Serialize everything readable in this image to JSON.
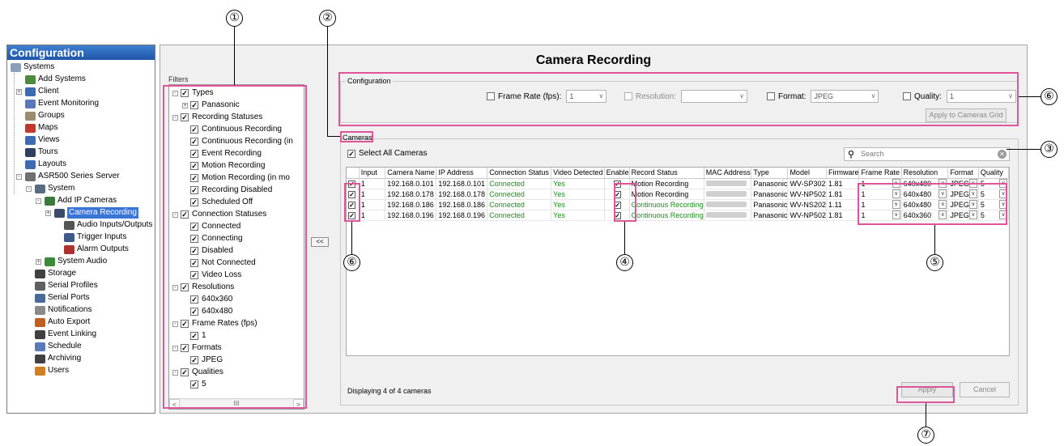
{
  "nav": {
    "header": "Configuration",
    "items": [
      {
        "label": "Systems",
        "color": "#8aa0b8"
      },
      {
        "label": "Add Systems",
        "color": "#4e8a3c"
      },
      {
        "label": "Client",
        "color": "#3d6bb3"
      },
      {
        "label": "Event Monitoring",
        "color": "#5a78b8"
      },
      {
        "label": "Groups",
        "color": "#9a8c6e"
      },
      {
        "label": "Maps",
        "color": "#c0392b"
      },
      {
        "label": "Views",
        "color": "#3d6bb3"
      },
      {
        "label": "Tours",
        "color": "#2f3f5f"
      },
      {
        "label": "Layouts",
        "color": "#3d6bb3"
      },
      {
        "label": "ASR500 Series Server",
        "color": "#707070"
      },
      {
        "label": "System",
        "color": "#5a6a80"
      },
      {
        "label": "Add IP Cameras",
        "color": "#3a7a3a"
      },
      {
        "label": "Camera Recording",
        "color": "#3a4a6a"
      },
      {
        "label": "Audio Inputs/Outputs",
        "color": "#555555"
      },
      {
        "label": "Trigger Inputs",
        "color": "#3d5a8a"
      },
      {
        "label": "Alarm Outputs",
        "color": "#b03030"
      },
      {
        "label": "System Audio",
        "color": "#3a8a3a"
      },
      {
        "label": "Storage",
        "color": "#404040"
      },
      {
        "label": "Serial Profiles",
        "color": "#606060"
      },
      {
        "label": "Serial Ports",
        "color": "#4a6a9a"
      },
      {
        "label": "Notifications",
        "color": "#8a8a8a"
      },
      {
        "label": "Auto Export",
        "color": "#c06020"
      },
      {
        "label": "Event Linking",
        "color": "#404040"
      },
      {
        "label": "Schedule",
        "color": "#5a7ab8"
      },
      {
        "label": "Archiving",
        "color": "#404040"
      },
      {
        "label": "Users",
        "color": "#d08020"
      }
    ]
  },
  "page": {
    "title": "Camera Recording",
    "collapse_label": "<<"
  },
  "filters": {
    "label": "Filters",
    "items": [
      {
        "label": "Types",
        "group": true
      },
      {
        "label": "Panasonic",
        "group": false
      },
      {
        "label": "Recording Statuses",
        "group": true
      },
      {
        "label": "Continuous Recording",
        "group": false
      },
      {
        "label": "Continuous Recording (in",
        "group": false
      },
      {
        "label": "Event Recording",
        "group": false
      },
      {
        "label": "Motion Recording",
        "group": false
      },
      {
        "label": "Motion Recording (in mo",
        "group": false
      },
      {
        "label": "Recording Disabled",
        "group": false
      },
      {
        "label": "Scheduled Off",
        "group": false
      },
      {
        "label": "Connection Statuses",
        "group": true
      },
      {
        "label": "Connected",
        "group": false
      },
      {
        "label": "Connecting",
        "group": false
      },
      {
        "label": "Disabled",
        "group": false
      },
      {
        "label": "Not Connected",
        "group": false
      },
      {
        "label": "Video Loss",
        "group": false
      },
      {
        "label": "Resolutions",
        "group": true
      },
      {
        "label": "640x360",
        "group": false
      },
      {
        "label": "640x480",
        "group": false
      },
      {
        "label": "Frame Rates (fps)",
        "group": true
      },
      {
        "label": "1",
        "group": false
      },
      {
        "label": "Formats",
        "group": true
      },
      {
        "label": "JPEG",
        "group": false
      },
      {
        "label": "Qualities",
        "group": true
      },
      {
        "label": "5",
        "group": false
      }
    ],
    "scroll_left": "<",
    "scroll_right": ">",
    "scroll_thumb": "III"
  },
  "configuration": {
    "label": "Configuration",
    "frame_rate_label": "Frame Rate (fps):",
    "frame_rate_value": "1",
    "resolution_label": "Resolution:",
    "resolution_value": "",
    "format_label": "Format:",
    "format_value": "JPEG",
    "quality_label": "Quality:",
    "quality_value": "1",
    "apply_grid_label": "Apply to Cameras Grid"
  },
  "cameras": {
    "label": "Cameras",
    "select_all_label": "Select All Cameras",
    "search_placeholder": "Search",
    "columns": [
      "",
      "Input",
      "Camera Name",
      "IP Address",
      "Connection Status",
      "Video Detected",
      "Enable",
      "Record Status",
      "MAC Address",
      "Type",
      "Model",
      "Firmware",
      "Frame Rate",
      "Resolution",
      "Format",
      "Quality"
    ],
    "rows": [
      {
        "input": "1",
        "name": "192.168.0.101",
        "ip": "192.168.0.101",
        "conn": "Connected",
        "video": "Yes",
        "record": "Motion Recording",
        "record_green": false,
        "type": "Panasonic",
        "model": "WV-SP302",
        "firmware": "1.81",
        "frame_rate": "1",
        "resolution": "640x480",
        "format": "JPEG",
        "quality": "5"
      },
      {
        "input": "1",
        "name": "192.168.0.178",
        "ip": "192.168.0.178",
        "conn": "Connected",
        "video": "Yes",
        "record": "Motion Recording",
        "record_green": false,
        "type": "Panasonic",
        "model": "WV-NP502",
        "firmware": "1.81",
        "frame_rate": "1",
        "resolution": "640x480",
        "format": "JPEG",
        "quality": "5"
      },
      {
        "input": "1",
        "name": "192.168.0.186",
        "ip": "192.168.0.186",
        "conn": "Connected",
        "video": "Yes",
        "record": "Continuous Recording",
        "record_green": true,
        "type": "Panasonic",
        "model": "WV-NS202",
        "firmware": "1.11",
        "frame_rate": "1",
        "resolution": "640x480",
        "format": "JPEG",
        "quality": "5"
      },
      {
        "input": "1",
        "name": "192.168.0.196",
        "ip": "192.168.0.196",
        "conn": "Connected",
        "video": "Yes",
        "record": "Continuous Recording",
        "record_green": true,
        "type": "Panasonic",
        "model": "WV-NP502",
        "firmware": "1.81",
        "frame_rate": "1",
        "resolution": "640x360",
        "format": "JPEG",
        "quality": "5"
      }
    ],
    "status_text": "Displaying 4 of 4 cameras",
    "apply_label": "Apply",
    "cancel_label": "Cancel"
  },
  "callouts": [
    "①",
    "②",
    "③",
    "④",
    "⑤",
    "⑥",
    "⑥",
    "⑦"
  ],
  "colors": {
    "highlight": "#e0559a",
    "selection": "#3875d7",
    "connected_green": "#1a8a1a",
    "header_blue": "#1f56a8"
  }
}
